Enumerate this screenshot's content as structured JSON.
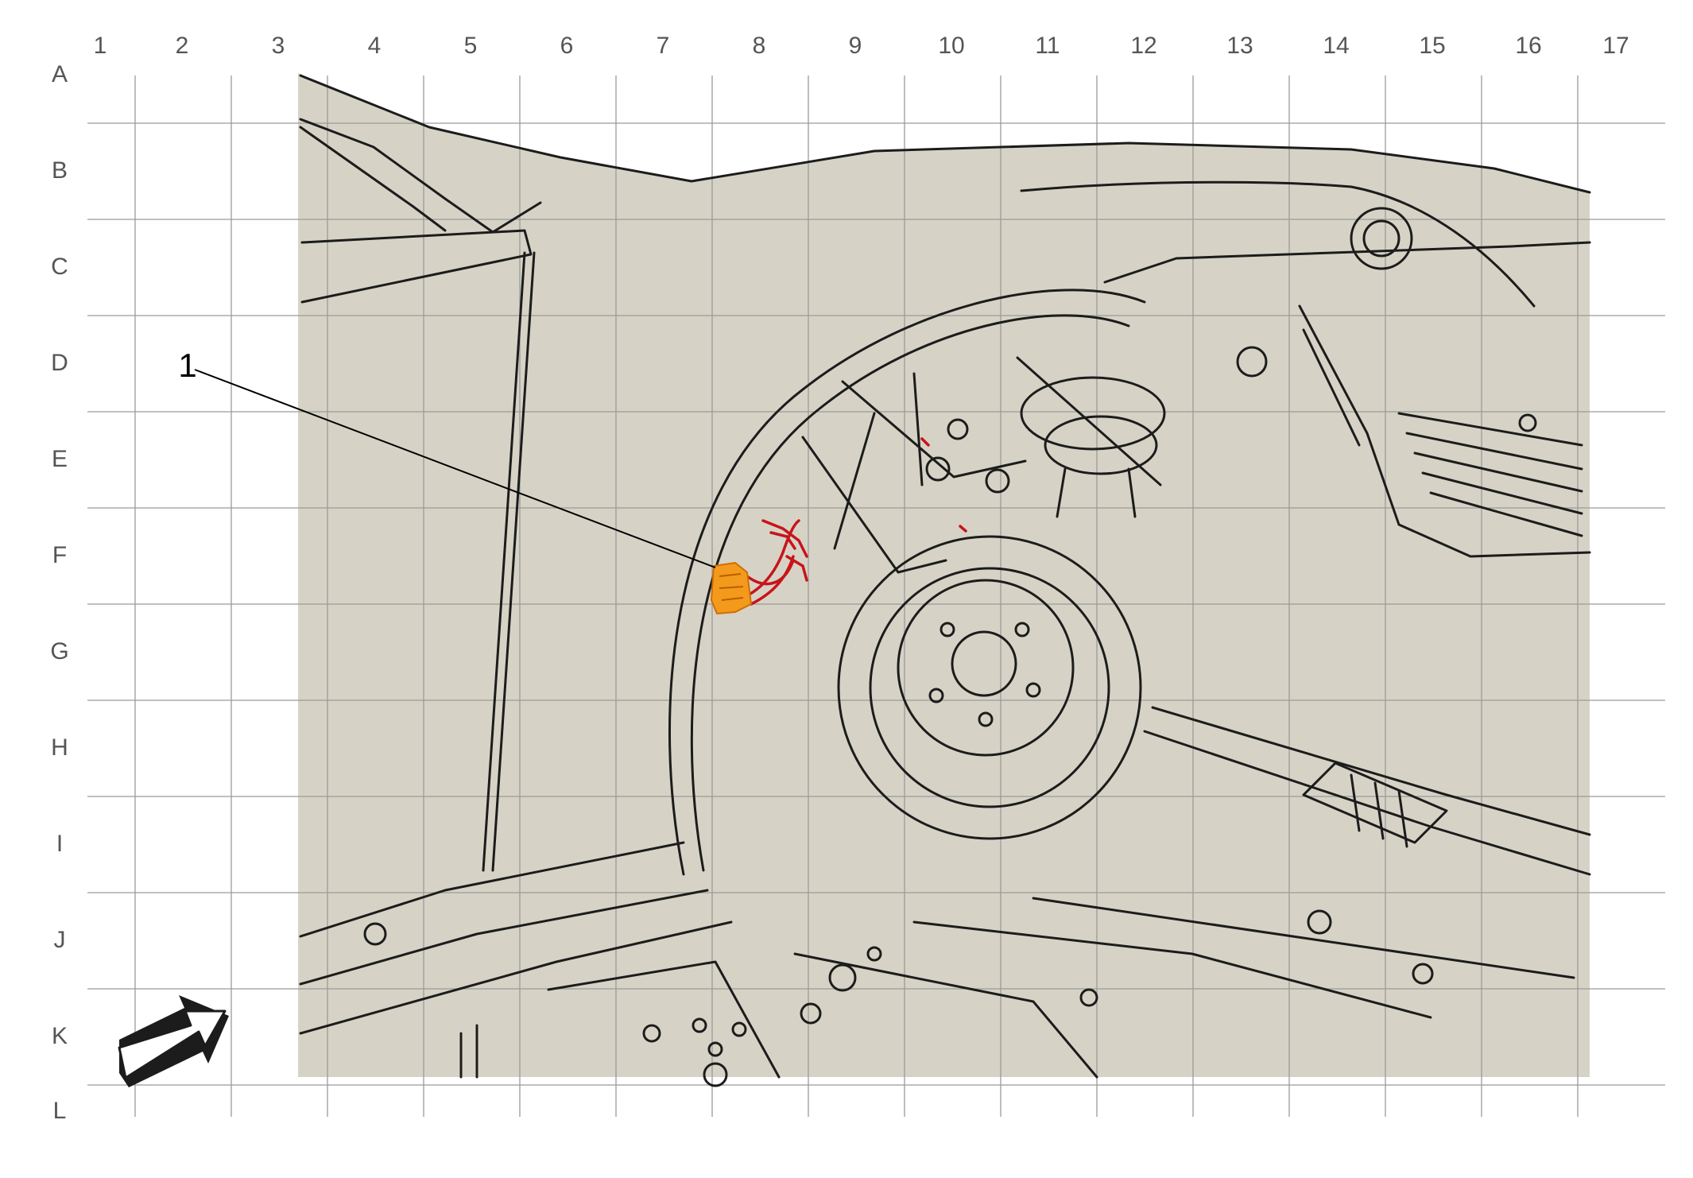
{
  "grid": {
    "columns": [
      "1",
      "2",
      "3",
      "4",
      "5",
      "6",
      "7",
      "8",
      "9",
      "10",
      "11",
      "12",
      "13",
      "14",
      "15",
      "16",
      "17"
    ],
    "rows": [
      "A",
      "B",
      "C",
      "D",
      "E",
      "F",
      "G",
      "H",
      "I",
      "J",
      "K",
      "L"
    ]
  },
  "callouts": [
    {
      "number": "1"
    }
  ],
  "colors": {
    "background": "#ffffff",
    "panel": "#d6d3c6",
    "line": "#1c1c1c",
    "grid": "#9a9a9a",
    "highlight_component": "#f39a1c",
    "highlight_harness": "#c8141a"
  },
  "icons": {
    "orientation_arrow": "front-direction-arrow-icon"
  }
}
